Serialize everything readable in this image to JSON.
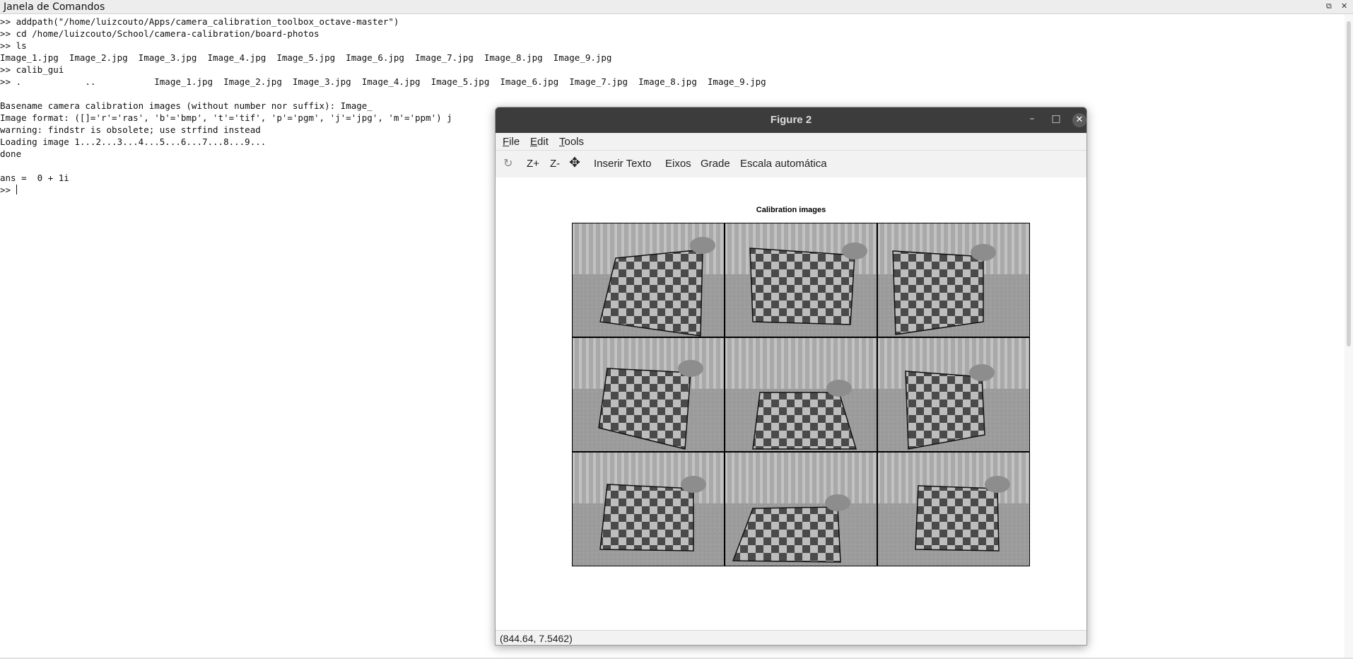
{
  "command_window": {
    "title": "Janela de Comandos",
    "undock_icon": "⧉",
    "close_icon": "✕",
    "lines": [
      ">> addpath(\"/home/luizcouto/Apps/camera_calibration_toolbox_octave-master\")",
      ">> cd /home/luizcouto/School/camera-calibration/board-photos",
      ">> ls",
      "Image_1.jpg  Image_2.jpg  Image_3.jpg  Image_4.jpg  Image_5.jpg  Image_6.jpg  Image_7.jpg  Image_8.jpg  Image_9.jpg",
      ">> calib_gui",
      ">> .            ..           Image_1.jpg  Image_2.jpg  Image_3.jpg  Image_4.jpg  Image_5.jpg  Image_6.jpg  Image_7.jpg  Image_8.jpg  Image_9.jpg",
      "",
      "Basename camera calibration images (without number nor suffix): Image_",
      "Image format: ([]='r'='ras', 'b'='bmp', 't'='tif', 'p'='pgm', 'j'='jpg', 'm'='ppm') j",
      "warning: findstr is obsolete; use strfind instead",
      "Loading image 1...2...3...4...5...6...7...8...9...",
      "done",
      "",
      "ans =  0 + 1i"
    ],
    "prompt": ">> "
  },
  "figure": {
    "title": "Figure 2",
    "controls": {
      "minimize": "–",
      "maximize": "□",
      "close": "✕"
    },
    "menu": [
      {
        "key": "F",
        "rest": "ile"
      },
      {
        "key": "E",
        "rest": "dit"
      },
      {
        "key": "T",
        "rest": "ools"
      }
    ],
    "toolbar": {
      "rotate_icon": "↻",
      "zoom_in": "Z+",
      "zoom_out": "Z-",
      "pan_icon": "✥",
      "insert_text": "Inserir Texto",
      "axes": "Eixos",
      "grid": "Grade",
      "autoscale": "Escala automática"
    },
    "axes_title": "Calibration images",
    "images": [
      "Image_1.jpg",
      "Image_2.jpg",
      "Image_3.jpg",
      "Image_4.jpg",
      "Image_5.jpg",
      "Image_6.jpg",
      "Image_7.jpg",
      "Image_8.jpg",
      "Image_9.jpg"
    ],
    "status_coords": "(844.64, 7.5462)"
  },
  "colors": {
    "titlebar": "#3c3c3c",
    "checker_dark": "#4a4a4a",
    "checker_light": "#bdbdbd"
  }
}
